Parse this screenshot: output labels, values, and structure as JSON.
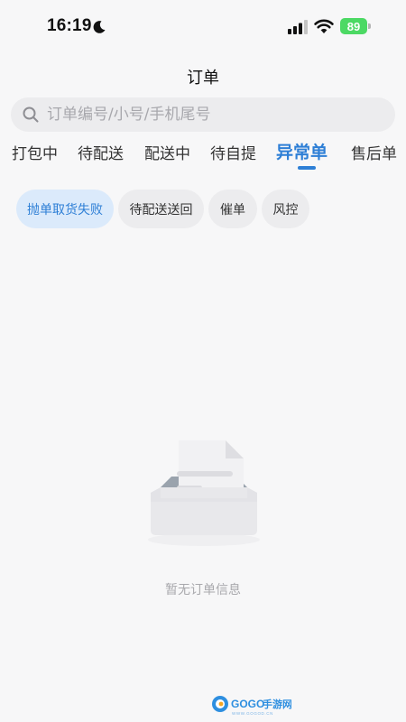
{
  "status_bar": {
    "time": "16:19",
    "battery": "89",
    "icons": [
      "moon-icon",
      "signal-icon",
      "wifi-icon",
      "battery-icon"
    ]
  },
  "header": {
    "title": "订单"
  },
  "search": {
    "placeholder": "订单编号/小号/手机尾号",
    "value": ""
  },
  "tabs": [
    {
      "label": "打包中"
    },
    {
      "label": "待配送"
    },
    {
      "label": "配送中"
    },
    {
      "label": "待自提"
    },
    {
      "label": "异常单",
      "active": true
    },
    {
      "label": "售后单"
    }
  ],
  "filters": [
    {
      "label": "抛单取货失败",
      "active": true
    },
    {
      "label": "待配送送回"
    },
    {
      "label": "催单"
    },
    {
      "label": "风控"
    }
  ],
  "empty_state": {
    "message": "暂无订单信息",
    "icon": "empty-inbox-icon"
  },
  "watermark": {
    "text": "GOGO手游网",
    "subtext": "WWW.GOGOD.CN"
  },
  "colors": {
    "accent": "#2e7fd6",
    "active_chip_bg": "#dbeafb",
    "chip_bg": "#ececee",
    "background": "#f7f7f8",
    "battery": "#4cd964"
  }
}
